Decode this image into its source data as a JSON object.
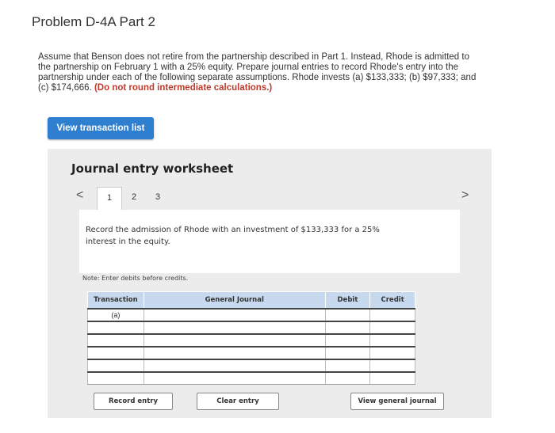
{
  "problem": {
    "title": "Problem D-4A Part 2",
    "instructions": "Assume that Benson does not retire from the partnership described in Part 1. Instead, Rhode is admitted to the partnership on February 1 with a 25% equity. Prepare journal entries to record Rhode's entry into the partnership under each of the following separate assumptions. Rhode invests (a) $133,333; (b) $97,333; and (c) $174,666.",
    "instructions_note": "(Do not round intermediate calculations.)"
  },
  "view_transaction_list": "View transaction list",
  "worksheet": {
    "title": "Journal entry worksheet",
    "nav_prev": "<",
    "nav_next": ">",
    "steps": [
      "1",
      "2",
      "3"
    ],
    "active_step": "1",
    "prompt": "Record the admission of Rhode with an investment of $133,333 for a 25% interest in the equity.",
    "note": "Note: Enter debits before credits.",
    "table": {
      "headers": {
        "transaction": "Transaction",
        "general_journal": "General Journal",
        "debit": "Debit",
        "credit": "Credit"
      },
      "rows": [
        {
          "transaction": "(a)",
          "general_journal": "",
          "debit": "",
          "credit": ""
        },
        {
          "transaction": "",
          "general_journal": "",
          "debit": "",
          "credit": ""
        },
        {
          "transaction": "",
          "general_journal": "",
          "debit": "",
          "credit": ""
        },
        {
          "transaction": "",
          "general_journal": "",
          "debit": "",
          "credit": ""
        },
        {
          "transaction": "",
          "general_journal": "",
          "debit": "",
          "credit": ""
        },
        {
          "transaction": "",
          "general_journal": "",
          "debit": "",
          "credit": ""
        }
      ]
    },
    "buttons": {
      "record_entry": "Record entry",
      "clear_entry": "Clear entry",
      "view_general_journal": "View general journal"
    }
  },
  "colors": {
    "accent": "#2f7fd1",
    "note_red": "#c0392b",
    "table_header": "#c7d9ee",
    "worksheet_bg": "#ececec"
  }
}
